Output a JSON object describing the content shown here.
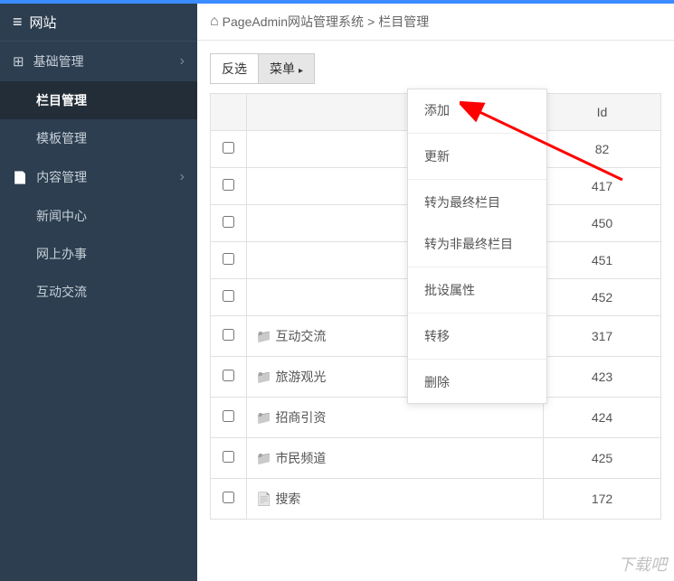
{
  "sidebar": {
    "title": "网站",
    "groups": [
      {
        "label": "基础管理",
        "items": [
          {
            "label": "栏目管理",
            "active": true
          },
          {
            "label": "模板管理",
            "active": false
          }
        ]
      },
      {
        "label": "内容管理",
        "items": [
          {
            "label": "新闻中心",
            "active": false
          },
          {
            "label": "网上办事",
            "active": false
          },
          {
            "label": "互动交流",
            "active": false
          }
        ]
      }
    ]
  },
  "breadcrumb": {
    "root": "PageAdmin网站管理系统",
    "sep": ">",
    "current": "栏目管理"
  },
  "toolbar": {
    "invert_label": "反选",
    "menu_label": "菜单"
  },
  "dropdown": {
    "add": "添加",
    "refresh": "更新",
    "to_final": "转为最终栏目",
    "to_nonfinal": "转为非最终栏目",
    "batch_attr": "批设属性",
    "move": "转移",
    "delete": "删除"
  },
  "table": {
    "header_id": "Id",
    "rows": [
      {
        "icon": "",
        "name": "",
        "id": "82"
      },
      {
        "icon": "",
        "name": "",
        "id": "417"
      },
      {
        "icon": "",
        "name": "",
        "id": "450"
      },
      {
        "icon": "",
        "name": "",
        "id": "451"
      },
      {
        "icon": "",
        "name": "",
        "id": "452"
      },
      {
        "icon": "folder",
        "name": "互动交流",
        "id": "317"
      },
      {
        "icon": "folder",
        "name": "旅游观光",
        "id": "423"
      },
      {
        "icon": "folder",
        "name": "招商引资",
        "id": "424"
      },
      {
        "icon": "folder",
        "name": "市民频道",
        "id": "425"
      },
      {
        "icon": "doc",
        "name": "搜索",
        "id": "172"
      }
    ]
  },
  "watermark": "下载吧"
}
